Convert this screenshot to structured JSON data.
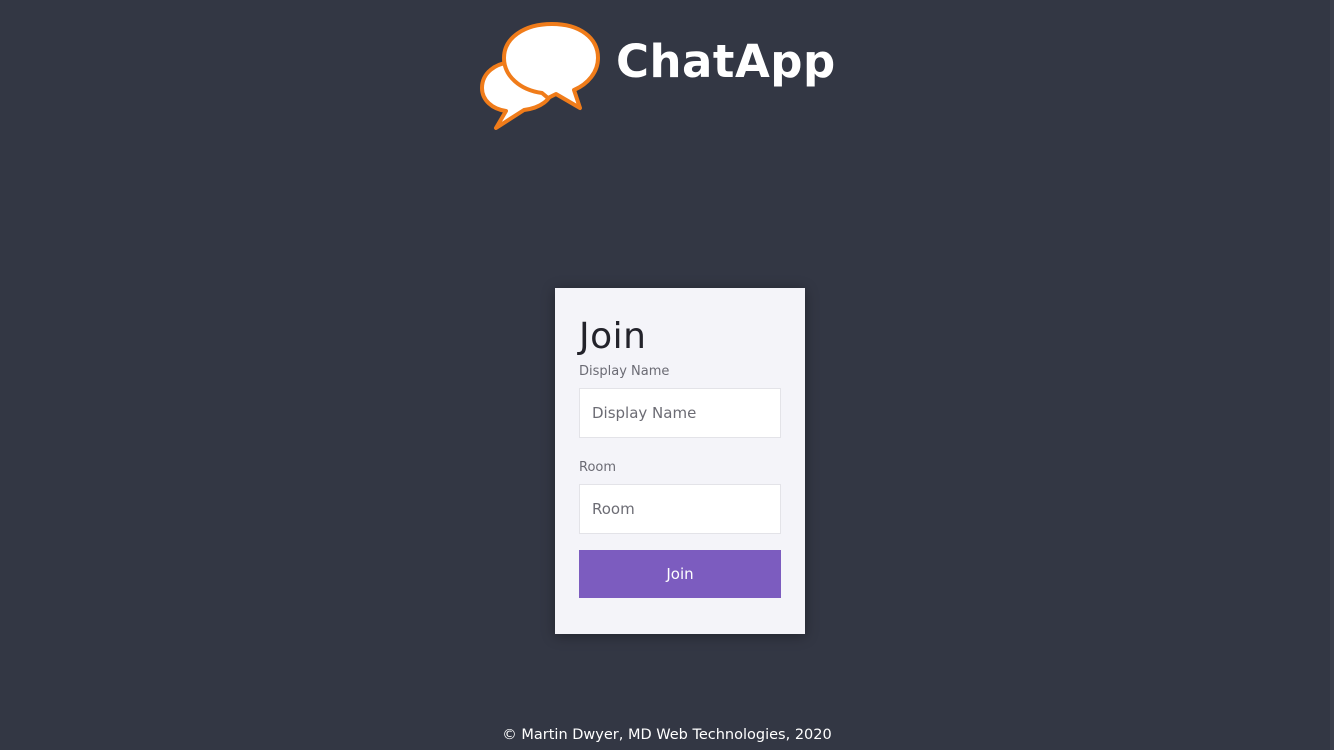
{
  "header": {
    "app_title": "ChatApp",
    "logo_icon": "chat-bubbles-icon"
  },
  "join_form": {
    "title": "Join",
    "display_name_label": "Display Name",
    "display_name_placeholder": "Display Name",
    "display_name_value": "",
    "room_label": "Room",
    "room_placeholder": "Room",
    "room_value": "",
    "submit_label": "Join"
  },
  "footer": {
    "text": "© Martin Dwyer, MD Web Technologies, 2020"
  },
  "colors": {
    "background": "#333744",
    "card": "#f4f4f9",
    "accent": "#7c5cbf",
    "logo_orange": "#f07c1a"
  }
}
